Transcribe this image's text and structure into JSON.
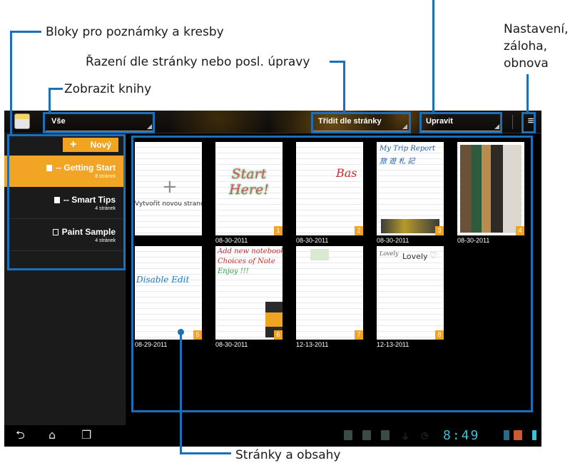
{
  "annotations": {
    "notebooks": "Bloky pro poznámky a kresby",
    "view_books": "Zobrazit knihy",
    "sort": "Řazení dle stránky nebo posl. úpravy",
    "settings_line1": "Nastavení,",
    "settings_line2": "záloha,",
    "settings_line3": "obnova",
    "pages": "Stránky a obsahy"
  },
  "topbar": {
    "filter_value": "Vše",
    "sort_value": "Třídit dle stránky",
    "edit_value": "Upravit"
  },
  "sidebar": {
    "new_label": "Nový",
    "notebooks": [
      {
        "title": "-- Getting Start",
        "count": "8 stránek",
        "selected": true
      },
      {
        "title": "-- Smart Tips",
        "count": "4 stránek",
        "selected": false
      },
      {
        "title": "Paint Sample",
        "count": "4 stránek",
        "selected": false
      }
    ]
  },
  "pages": {
    "new_page_label": "Vytvořit novou stranu",
    "items": [
      {
        "number": "1",
        "date": "08-30-2011",
        "text": "Start Here!"
      },
      {
        "number": "2",
        "date": "08-30-2011",
        "text": "Bas"
      },
      {
        "number": "3",
        "date": "08-30-2011",
        "text": "My Trip Report"
      },
      {
        "number": "4",
        "date": "08-30-2011",
        "text": ""
      },
      {
        "number": "5",
        "date": "08-29-2011",
        "text": "Disable Edit"
      },
      {
        "number": "6",
        "date": "08-30-2011",
        "text": "Add new notebook"
      },
      {
        "number": "7",
        "date": "12-13-2011",
        "text": ""
      },
      {
        "number": "8",
        "date": "12-13-2011",
        "text": "Lovely"
      }
    ]
  },
  "status": {
    "clock": "8:49"
  },
  "colors": {
    "accent": "#f0a422",
    "callout": "#1c6fb8",
    "clock": "#36c3d8"
  }
}
